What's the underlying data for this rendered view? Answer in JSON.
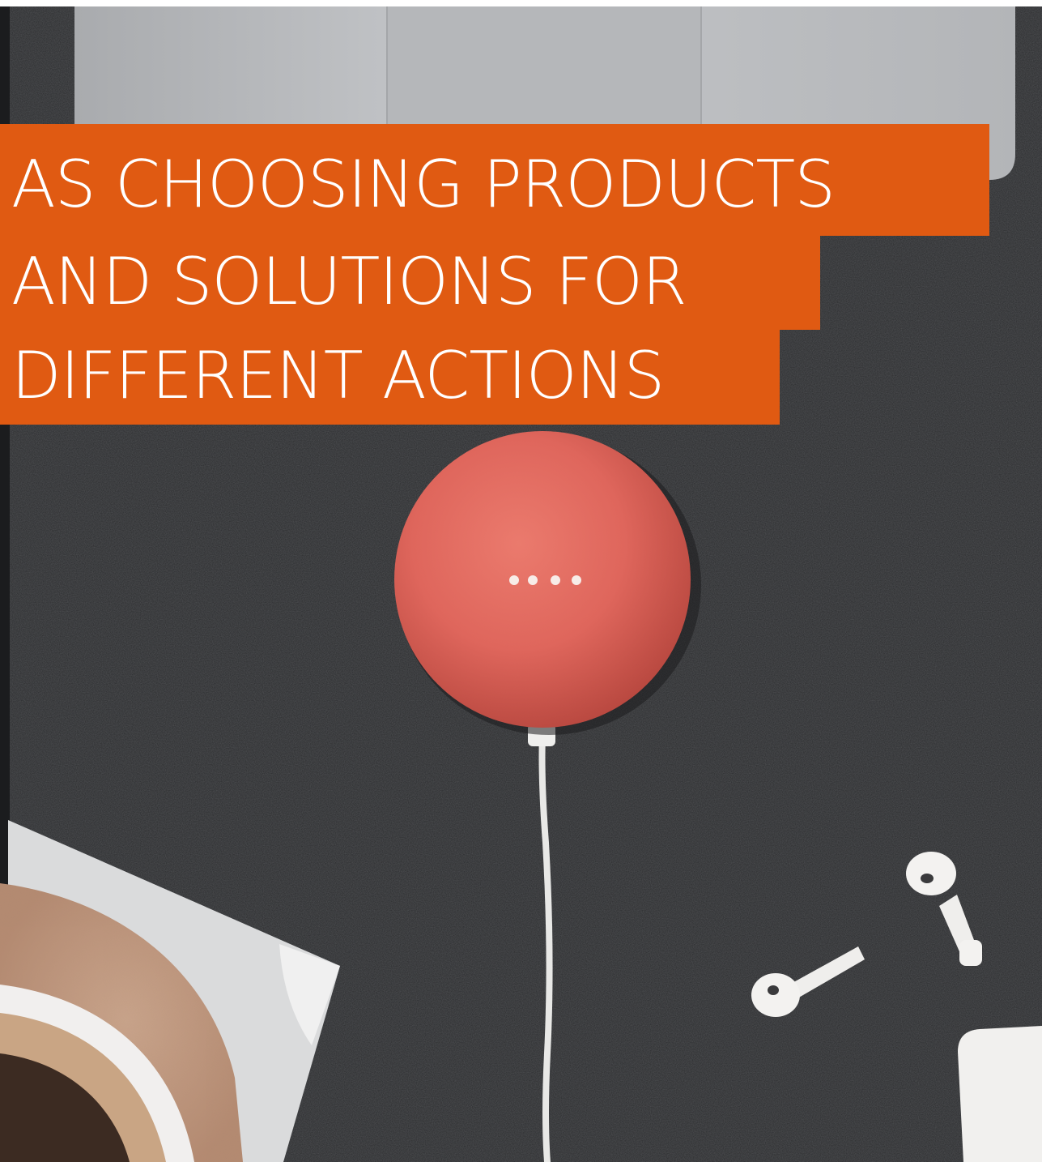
{
  "headline": {
    "line1": "AS CHOOSING PRODUCTS",
    "line2": "AND SOLUTIONS FOR",
    "line3": "DIFFERENT ACTIONS"
  },
  "colors": {
    "accent": "#e05a12",
    "headline_text": "#ffffff",
    "felt_background": "#2a2b2d",
    "speaker": "#e2685e",
    "laptop": "#b8babd"
  },
  "photo": {
    "objects": [
      "laptop",
      "smart-speaker",
      "charging-cable",
      "earbuds",
      "earbuds-case",
      "cork-coaster",
      "coffee-cup",
      "white-tray"
    ]
  }
}
